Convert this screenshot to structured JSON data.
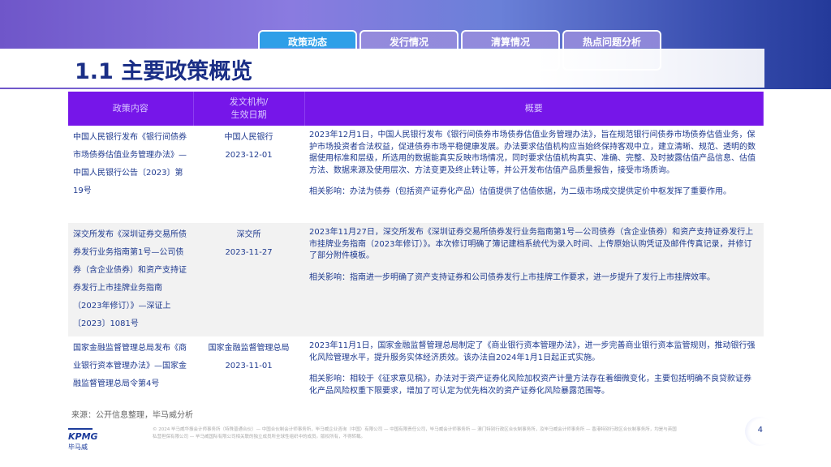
{
  "tabs": [
    "政策动态",
    "发行情况",
    "清算情况",
    "热点问题分析"
  ],
  "title": "1.1 主要政策概览",
  "table": {
    "headers": [
      "政策内容",
      "发文机构/\n生效日期",
      "概要"
    ],
    "rows": [
      {
        "content": "中国人民银行发布《银行间债券市场债券估值业务管理办法》—中国人民银行公告〔2023〕第19号",
        "agency": "中国人民银行",
        "date": "2023-12-01",
        "summary": "2023年12月1日，中国人民银行发布《银行间债券市场债券估值业务管理办法》，旨在规范银行间债券市场债券估值业务，保护市场投资者合法权益，促进债券市场平稳健康发展。办法要求估值机构应当始终保持客观中立，建立清晰、规范、透明的数据使用标准和层级，所选用的数据能真实反映市场情况，同时要求估值机构真实、准确、完整、及时披露估值产品信息、估值方法、数据来源及使用层次、方法变更及终止转让等，并公开发布估值产品质量报告，接受市场质询。",
        "impact": "相关影响：办法为债券（包括资产证券化产品）估值提供了估值依据，为二级市场成交提供定价中枢发挥了重要作用。"
      },
      {
        "content": "深交所发布《深圳证券交易所债券发行业务指南第1号—公司债券（含企业债券）和资产支持证券发行上市挂牌业务指南（2023年修订）》—深证上〔2023〕1081号",
        "agency": "深交所",
        "date": "2023-11-27",
        "summary": "2023年11月27日，深交所发布《深圳证券交易所债券发行业务指南第1号—公司债券（含企业债券）和资产支持证券发行上市挂牌业务指南（2023年修订）》。本次修订明确了簿记建档系统代为录入时间、上传原始认购凭证及邮件传真记录，并修订了部分附件模板。",
        "impact": "相关影响：指南进一步明确了资产支持证券和公司债券发行上市挂牌工作要求，进一步提升了发行上市挂牌效率。"
      },
      {
        "content": "国家金融监督管理总局发布《商业银行资本管理办法》—国家金融监督管理总局令第4号",
        "agency": "国家金融监督管理总局",
        "date": "2023-11-01",
        "summary": "2023年11月1日，国家金融监督管理总局制定了《商业银行资本管理办法》，进一步完善商业银行资本监管规则，推动银行强化风险管理水平，提升服务实体经济质效。该办法自2024年1月1日起正式实施。",
        "impact": "相关影响：相较于《征求意见稿》，办法对于资产证券化风险加权资产计量方法存在着细微变化，主要包括明确不良贷款证券化产品风险权重下限要求，增加了可认定为优先档次的资产证券化风险暴露范围等。"
      }
    ]
  },
  "source": "来源：公开信息整理，毕马威分析",
  "logo": {
    "brand": "KPMG",
    "cn": "毕马威"
  },
  "copyright": "© 2024 毕马威华振会计师事务所（特殊普通合伙）— 中国合伙制会计师事务所，毕马威企业咨询（中国）有限公司 — 中国有限责任公司，毕马威会计师事务所 — 澳门特别行政区合伙制事务所，及毕马威会计师事务所 — 香港特别行政区合伙制事务所，均是与英国私营担保有限公司 — 毕马威国际有限公司相关联的独立成员所全球性组织中的成员。版权所有，不得转载。",
  "page_number": "4"
}
